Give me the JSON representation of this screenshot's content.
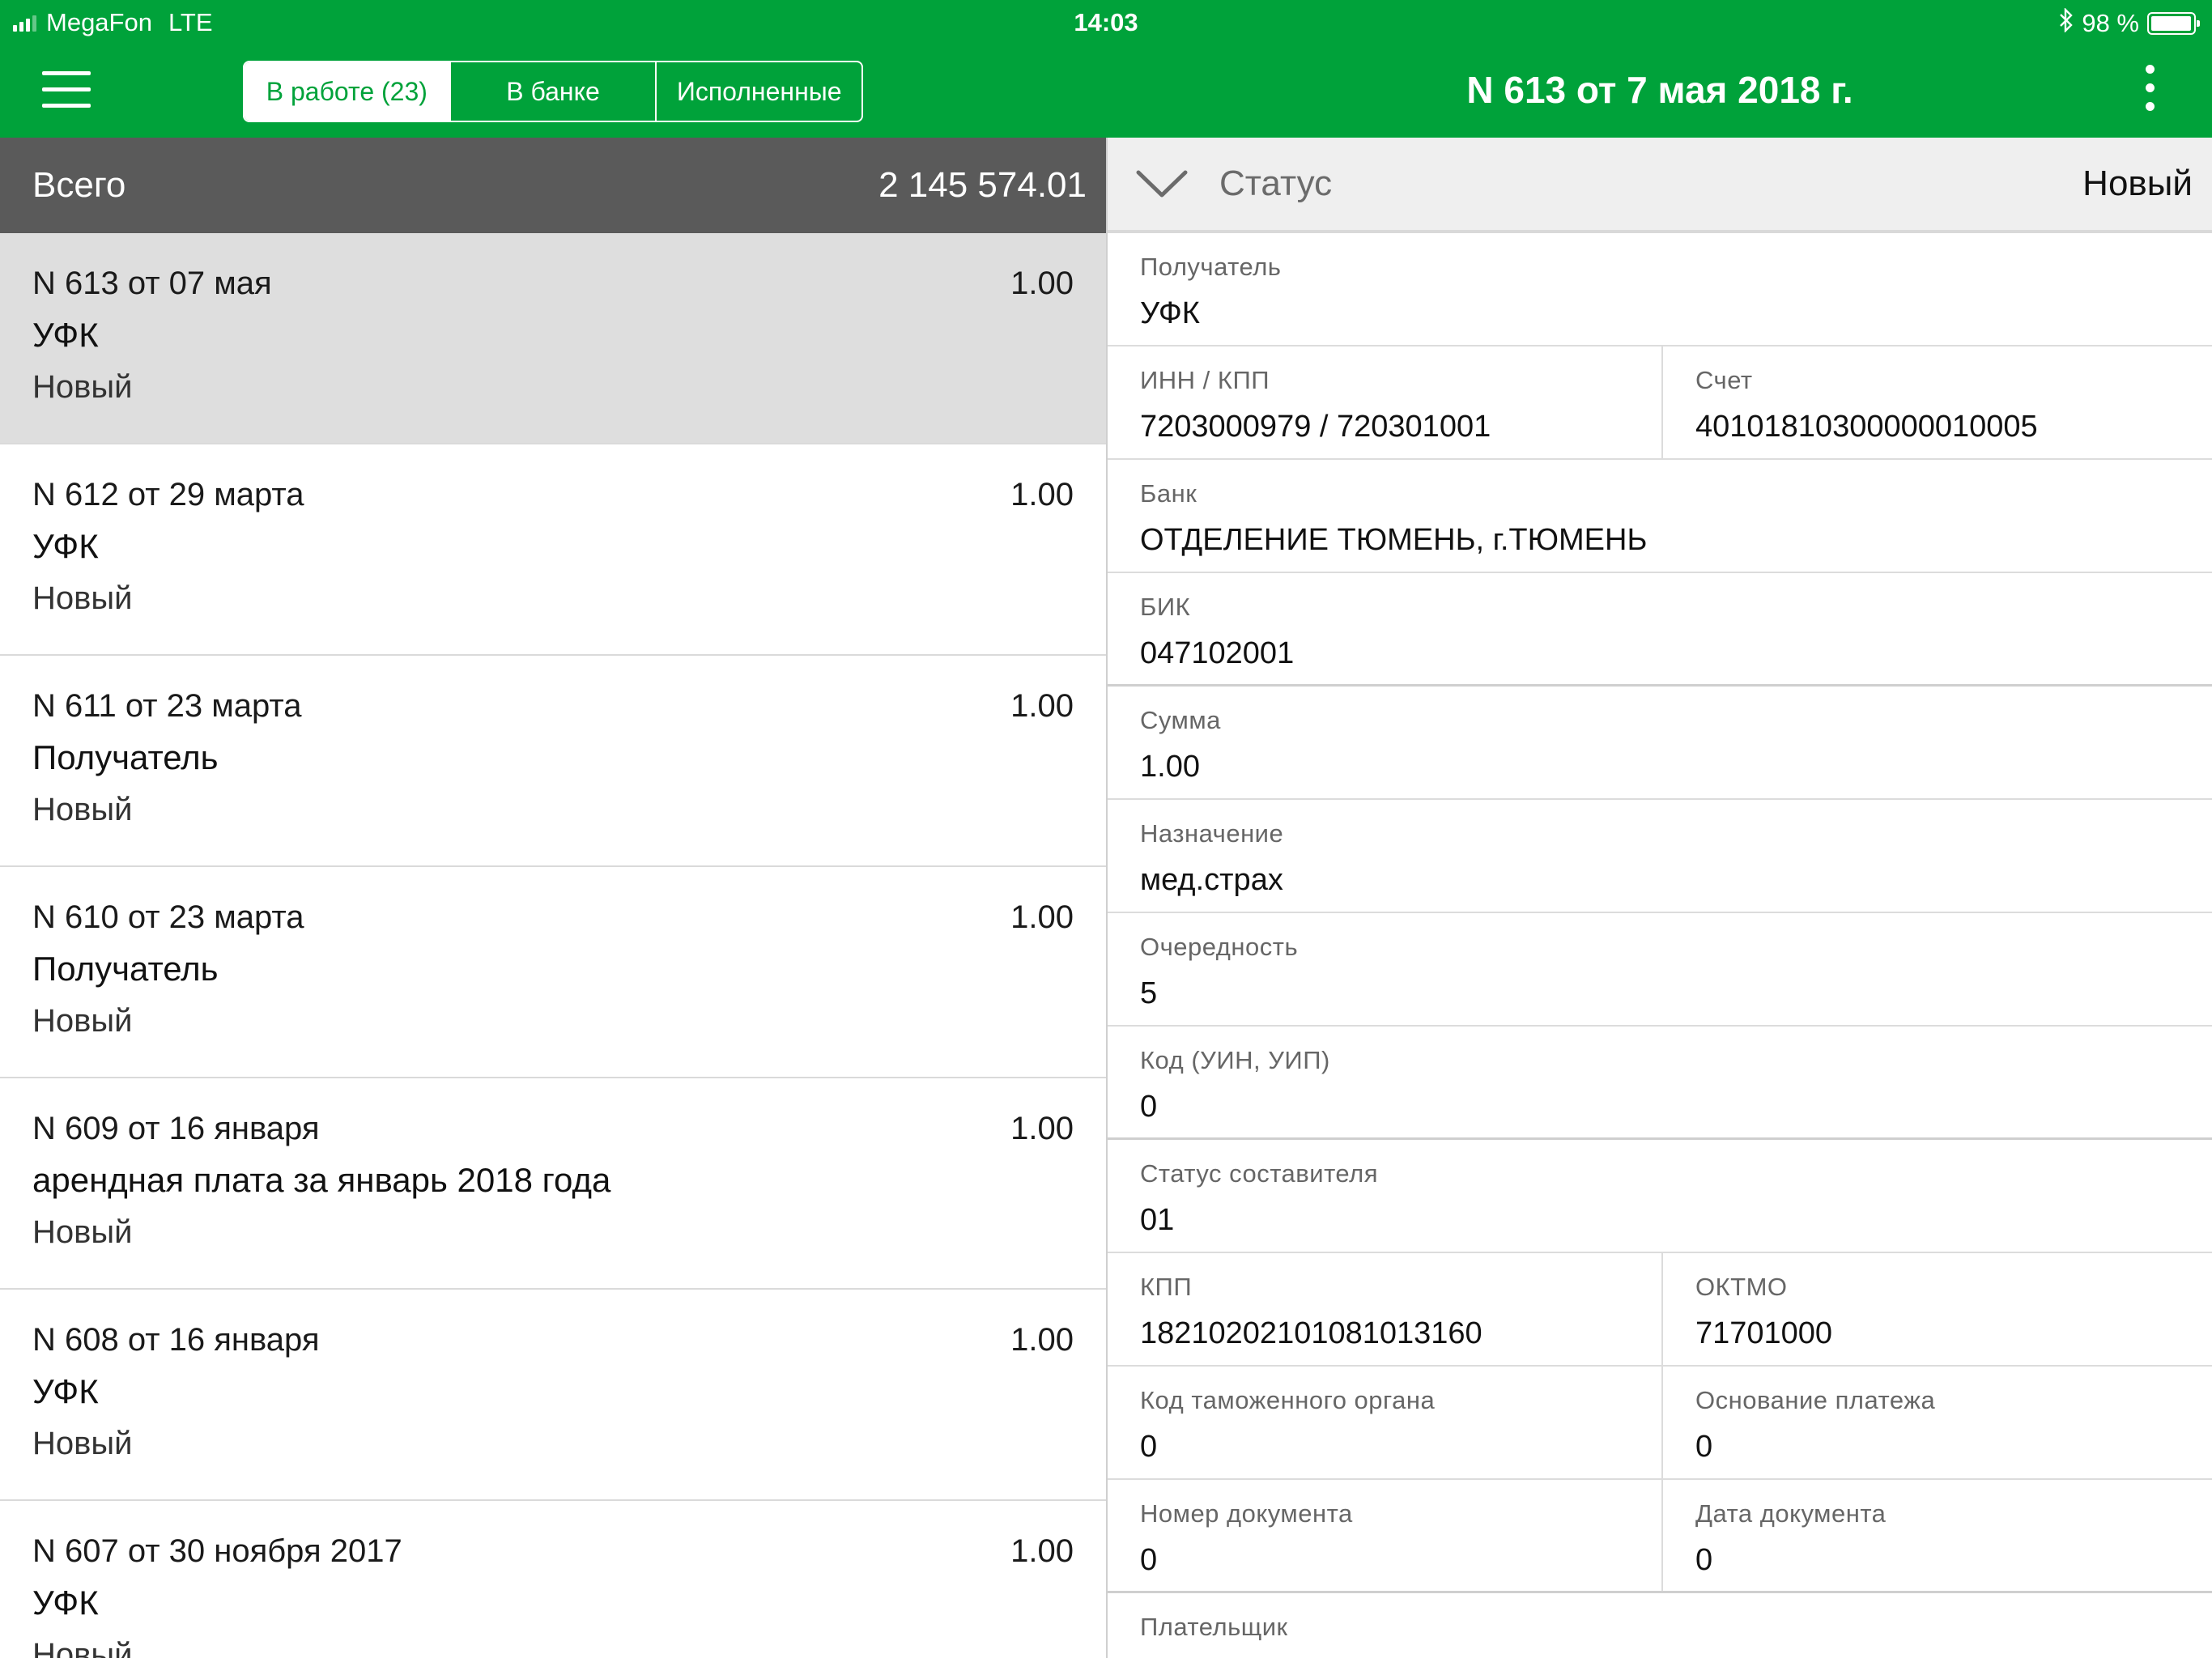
{
  "status_bar": {
    "carrier": "MegaFon",
    "network": "LTE",
    "time": "14:03",
    "battery": "98 %",
    "battery_level": 0.98
  },
  "header": {
    "tabs": [
      {
        "label": "В работе (23)",
        "active": true
      },
      {
        "label": "В банке",
        "active": false
      },
      {
        "label": "Исполненные",
        "active": false
      }
    ],
    "document_title": "N 613 от 7 мая 2018 г."
  },
  "list": {
    "total_label": "Всего",
    "total_value": "2 145 574.01",
    "items": [
      {
        "title": "N 613 от 07 мая",
        "amount": "1.00",
        "recipient": "УФК",
        "status": "Новый"
      },
      {
        "title": "N 612 от 29 марта",
        "amount": "1.00",
        "recipient": "УФК",
        "status": "Новый"
      },
      {
        "title": "N 611 от 23 марта",
        "amount": "1.00",
        "recipient": "Получатель",
        "status": "Новый"
      },
      {
        "title": "N 610 от 23 марта",
        "amount": "1.00",
        "recipient": "Получатель",
        "status": "Новый"
      },
      {
        "title": "N 609 от 16 января",
        "amount": "1.00",
        "recipient": "арендная плата за январь 2018 года",
        "status": "Новый"
      },
      {
        "title": "N 608 от 16 января",
        "amount": "1.00",
        "recipient": "УФК",
        "status": "Новый"
      },
      {
        "title": "N 607 от 30 ноября 2017",
        "amount": "1.00",
        "recipient": "УФК",
        "status": "Новый"
      }
    ]
  },
  "details": {
    "status_label": "Статус",
    "status_value": "Новый",
    "recipient_label": "Получатель",
    "recipient_value": "УФК",
    "inn_kpp_label": "ИНН / КПП",
    "inn_kpp_value": "7203000979 / 720301001",
    "account_label": "Счет",
    "account_value": "40101810300000010005",
    "bank_label": "Банк",
    "bank_value": "ОТДЕЛЕНИЕ ТЮМЕНЬ, г.ТЮМЕНЬ",
    "bik_label": "БИК",
    "bik_value": "047102001",
    "sum_label": "Сумма",
    "sum_value": "1.00",
    "purpose_label": "Назначение",
    "purpose_value": "мед.страх",
    "priority_label": "Очередность",
    "priority_value": "5",
    "code_label": "Код (УИН, УИП)",
    "code_value": "0",
    "composer_status_label": "Статус составителя",
    "composer_status_value": "01",
    "kpp_label": "КПП",
    "kpp_value": "18210202101081013160",
    "oktmo_label": "ОКТМО",
    "oktmo_value": "71701000",
    "customs_label": "Код таможенного органа",
    "customs_value": "0",
    "basis_label": "Основание платежа",
    "basis_value": "0",
    "doc_number_label": "Номер документа",
    "doc_number_value": "0",
    "doc_date_label": "Дата документа",
    "doc_date_value": "0",
    "payer_label": "Плательщик"
  },
  "colors": {
    "brand_green": "#00a23a",
    "total_bar": "#5a5a5a",
    "selected_row": "#dedede"
  }
}
